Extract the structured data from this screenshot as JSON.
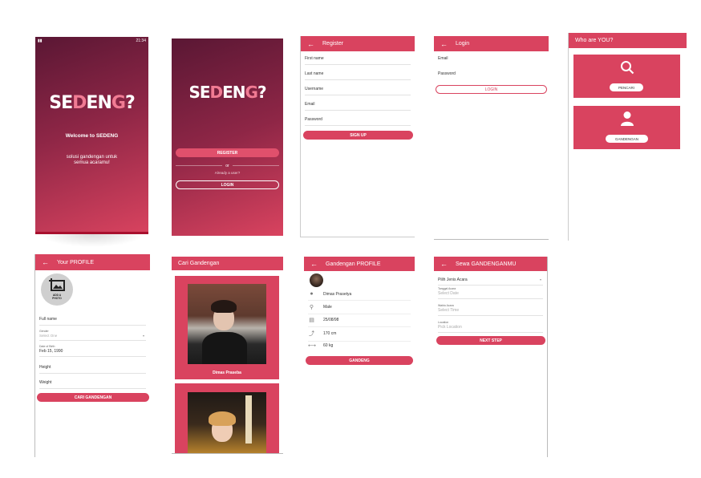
{
  "splash": {
    "status_left": "all",
    "status_right": "21:34",
    "logo_part1": "SE",
    "logo_part2": "D",
    "logo_part3": "EN",
    "logo_part4": "G",
    "logo_part5": "?",
    "welcome": "Welcome to SEDENG",
    "tagline_line1": "solusi gandengan untuk",
    "tagline_line2": "semua acaramu!"
  },
  "start": {
    "register_label": "REGISTER",
    "or_label": "or",
    "already_label": "Already a user?",
    "login_label": "LOGIN"
  },
  "register": {
    "title": "Register",
    "fields": [
      "First name",
      "Last name",
      "Username",
      "Email",
      "Password"
    ],
    "signup_label": "SIGN UP"
  },
  "login": {
    "title": "Login",
    "fields": [
      "Email",
      "Password"
    ],
    "login_label": "LOGIN"
  },
  "who": {
    "title": "Who are YOU?",
    "option1": "PENCARI",
    "option2": "GANDENGAN"
  },
  "profile": {
    "title": "Your PROFILE",
    "add_photo": "ADD A PHOTO",
    "fullname_label": "Full name",
    "gender_label": "Gender",
    "gender_placeholder": "Select One",
    "dob_label": "Date of Birth",
    "dob_value": "Feb 15, 1990",
    "height_label": "Height",
    "weight_label": "Weight",
    "button_label": "CARI GANDENGAN"
  },
  "cari": {
    "title": "Cari Gandengan",
    "card1_name": "Dimas Praseba"
  },
  "gprofile": {
    "title": "Gandengan PROFILE",
    "name": "Dimas Prasetya",
    "gender": "Male",
    "dob": "25/08/98",
    "height": "170 cm",
    "weight": "60 kg",
    "button_label": "GANDENG"
  },
  "sewa": {
    "title": "Sewa GANDENGANMU",
    "event_placeholder": "Pilih Jenis Acara",
    "date_label": "Tanggal Acara",
    "date_placeholder": "Select Date",
    "time_label": "Waktu Acara",
    "time_placeholder": "Select Time",
    "location_label": "Location",
    "location_placeholder": "Pick Location",
    "next_label": "NEXT STEP"
  },
  "colors": {
    "accent": "#d9435f",
    "gradient_top": "#5c1836",
    "gradient_bottom": "#d9435f"
  }
}
